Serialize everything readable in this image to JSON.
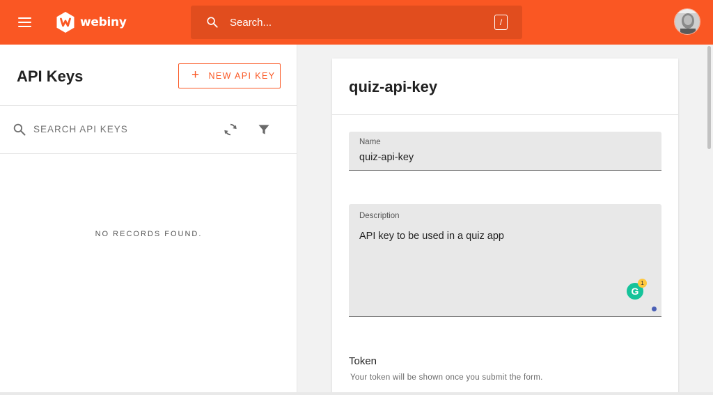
{
  "header": {
    "logo_text": "webiny",
    "search_placeholder": "Search...",
    "search_shortcut": "/",
    "brand_color": "#fa5723"
  },
  "sidebar": {
    "title": "API Keys",
    "new_button_plus": "+",
    "new_button_label": "NEW API KEY",
    "search_placeholder": "SEARCH API KEYS",
    "empty_message": "NO RECORDS FOUND."
  },
  "form": {
    "title": "quiz-api-key",
    "name_label": "Name",
    "name_value": "quiz-api-key",
    "description_label": "Description",
    "description_value": "API key to be used in a quiz app",
    "grammarly_letter": "G",
    "grammarly_count": "1",
    "token_title": "Token",
    "token_help": "Your token will be shown once you submit the form."
  }
}
